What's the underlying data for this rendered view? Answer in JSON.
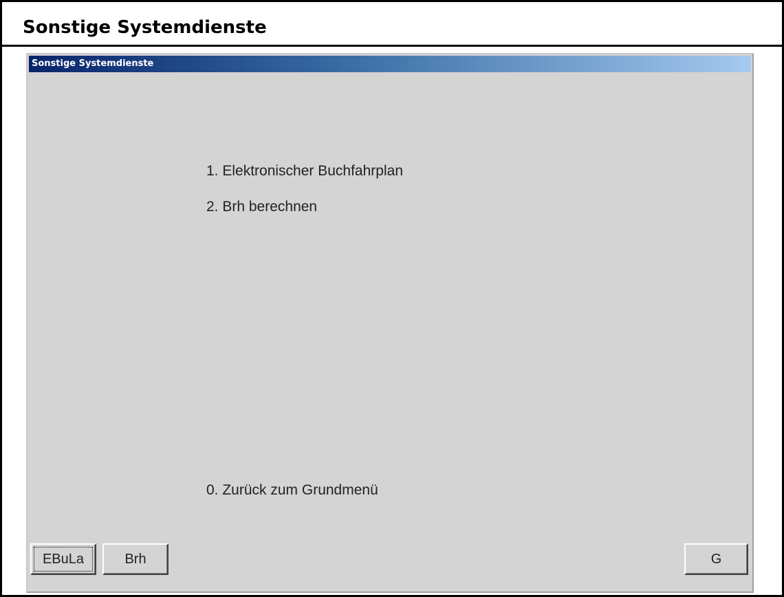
{
  "page": {
    "title": "Sonstige Systemdienste"
  },
  "window": {
    "title": "Sonstige Systemdienste"
  },
  "menu": {
    "items": [
      "1. Elektronischer Buchfahrplan",
      "2. Brh berechnen"
    ],
    "back": "0. Zurück zum Grundmenü"
  },
  "buttons": {
    "ebula": "EBuLa",
    "brh": "Brh",
    "g": "G"
  }
}
